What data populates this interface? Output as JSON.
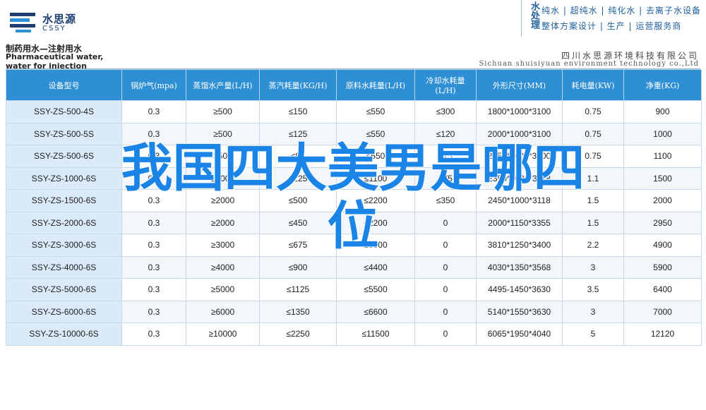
{
  "logo": {
    "cn": "水思源",
    "en": "CSSY"
  },
  "brand": {
    "vertical": "水处理",
    "line1": "纯水 | 超纯水 | 纯化水 | 去离子水设备",
    "line2": "整体方案设计 | 生产 | 运营服务商"
  },
  "product": {
    "title_cn": "制药用水—注射用水",
    "title_en": "Pharmaceutical water, water for injection"
  },
  "company": {
    "name_cn": "四川水思源环境科技有限公司",
    "name_en": "Sichuan shuisiyuan environment technology co.,Ltd"
  },
  "table": {
    "headers": [
      "设备型号",
      "锅炉气(mpa)",
      "蒸馏水产量(L/H)",
      "蒸汽耗量(KG/H)",
      "原料水耗量(L/H)",
      "冷却水耗量(L/H)",
      "外形尺寸(MM)",
      "耗电量(KW)",
      "净重(KG)"
    ],
    "rows": [
      [
        "SSY-ZS-500-4S",
        "0.3",
        "≥500",
        "≤150",
        "≤550",
        "≤300",
        "1800*1000*3100",
        "0.75",
        "900"
      ],
      [
        "SSY-ZS-500-5S",
        "0.3",
        "≥500",
        "≤125",
        "≤550",
        "≤120",
        "2000*1000*3100",
        "0.75",
        "1000"
      ],
      [
        "SSY-ZS-500-6S",
        "0.3",
        "≥500",
        "≤95",
        "≤550",
        "≤75",
        "2150*1000*3100",
        "0.75",
        "1100"
      ],
      [
        "SSY-ZS-1000-6S",
        "0.3",
        "≥1000",
        "≤225",
        "≤1100",
        "≤75",
        "2350*1000*3118",
        "1.1",
        "1500"
      ],
      [
        "SSY-ZS-1500-6S",
        "0.3",
        "≥2000",
        "≤500",
        "≤2200",
        "≤350",
        "2450*1000*3118",
        "1.5",
        "2000"
      ],
      [
        "SSY-ZS-2000-6S",
        "0.3",
        "≥2000",
        "≤450",
        "≤2200",
        "0",
        "2000*1150*3355",
        "1.5",
        "2950"
      ],
      [
        "SSY-ZS-3000-6S",
        "0.3",
        "≥3000",
        "≤675",
        "≤3300",
        "0",
        "3810*1250*3400",
        "2.2",
        "4900"
      ],
      [
        "SSY-ZS-4000-6S",
        "0.3",
        "≥4000",
        "≤900",
        "≤4400",
        "0",
        "4030*1350*3568",
        "3",
        "5900"
      ],
      [
        "SSY-ZS-5000-6S",
        "0.3",
        "≥5000",
        "≤1125",
        "≤5500",
        "0",
        "4495-1450*3630",
        "3.5",
        "6400"
      ],
      [
        "SSY-ZS-6000-6S",
        "0.3",
        "≥6000",
        "≤1350",
        "≤6600",
        "0",
        "5140*1550*3630",
        "3",
        "7000"
      ],
      [
        "SSY-ZS-10000-6S",
        "0.3",
        "≥10000",
        "≤2250",
        "≤11500",
        "0",
        "6065*1950*4040",
        "5",
        "12120"
      ]
    ]
  },
  "overlay_title": "我国四大美男是哪四位",
  "colors": {
    "header_blue": "#2e8fd5",
    "overlay_blue": "#1a85e6",
    "brand_blue": "#1e5f9e"
  }
}
